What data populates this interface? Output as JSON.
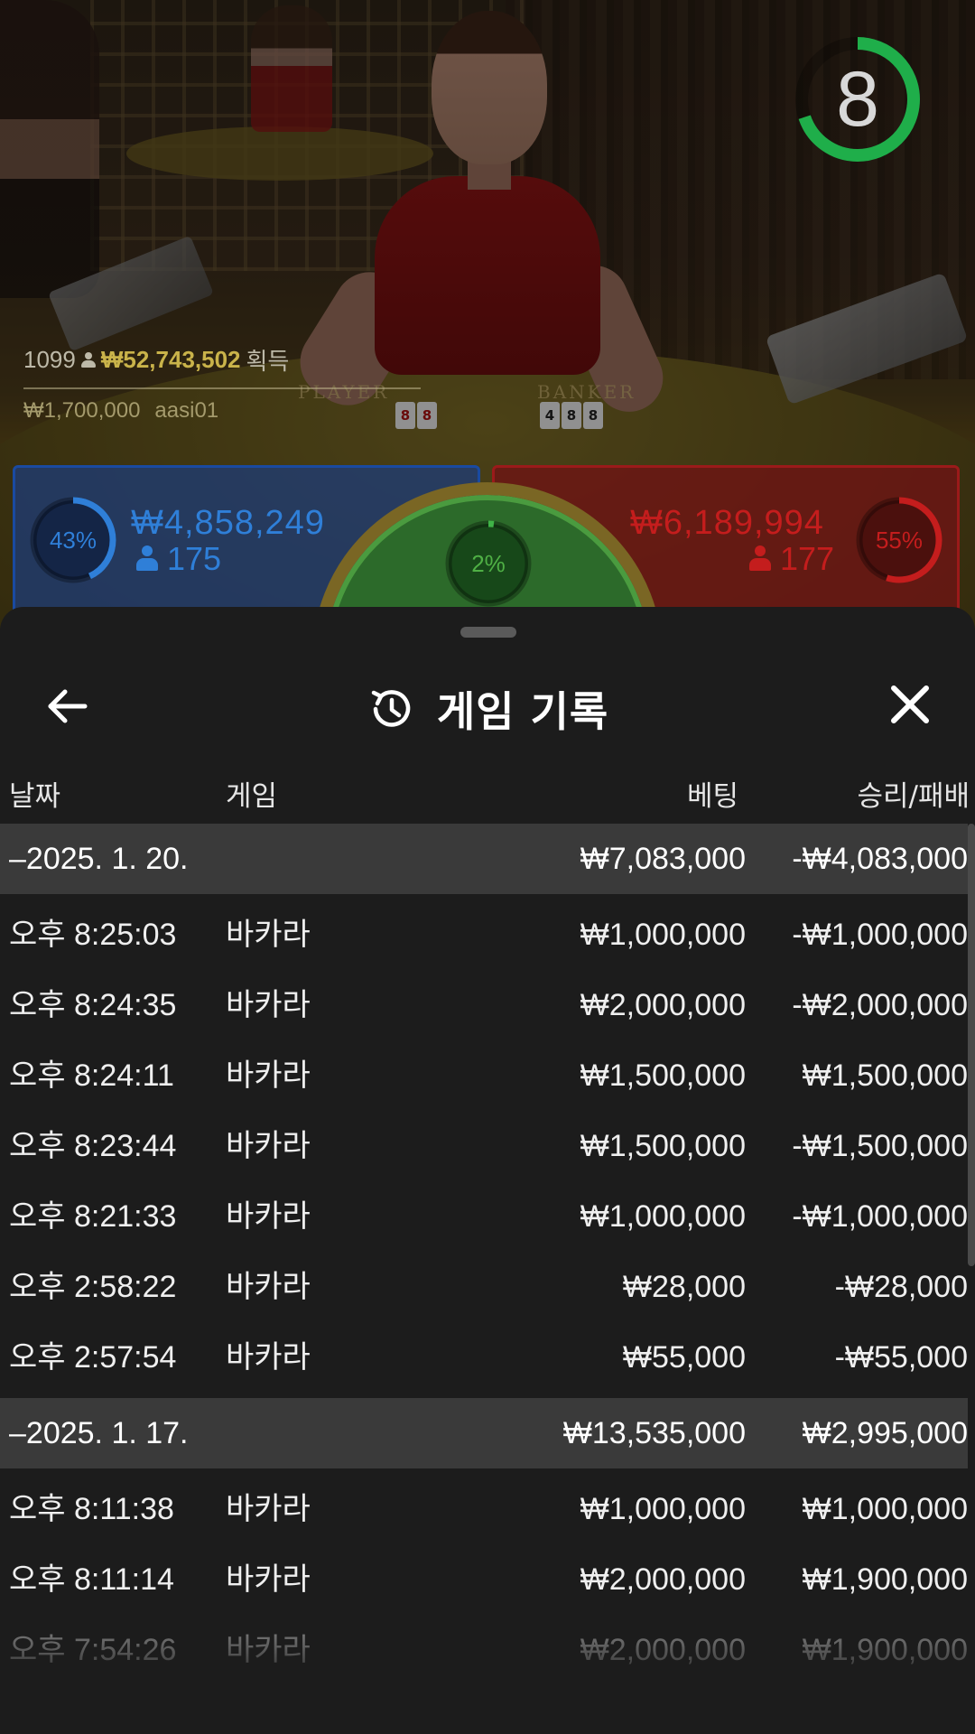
{
  "live": {
    "timer": "8",
    "winner": {
      "count": "1099",
      "amount": "₩52,743,502",
      "suffix": "획득",
      "bet": "₩1,700,000",
      "user": "aasi01"
    },
    "felt": {
      "player": "PLAYER",
      "banker": "BANKER"
    },
    "player": {
      "percent": "43%",
      "amount": "₩4,858,249",
      "count": "175",
      "color": "#2f7fd8"
    },
    "tie": {
      "percent": "2%",
      "color": "#3fb347"
    },
    "banker": {
      "percent": "55%",
      "amount": "₩6,189,994",
      "count": "177",
      "color": "#c41d1d"
    }
  },
  "sheet": {
    "title": "게임 기록",
    "columns": {
      "date": "날짜",
      "game": "게임",
      "bet": "베팅",
      "result": "승리/패배"
    },
    "groups": [
      {
        "date": "–2025. 1. 20.",
        "total_bet": "₩7,083,000",
        "total_result": "-₩4,083,000",
        "rows": [
          {
            "time": "오후 8:25:03",
            "game": "바카라",
            "bet": "₩1,000,000",
            "result": "-₩1,000,000"
          },
          {
            "time": "오후 8:24:35",
            "game": "바카라",
            "bet": "₩2,000,000",
            "result": "-₩2,000,000"
          },
          {
            "time": "오후 8:24:11",
            "game": "바카라",
            "bet": "₩1,500,000",
            "result": "₩1,500,000"
          },
          {
            "time": "오후 8:23:44",
            "game": "바카라",
            "bet": "₩1,500,000",
            "result": "-₩1,500,000"
          },
          {
            "time": "오후 8:21:33",
            "game": "바카라",
            "bet": "₩1,000,000",
            "result": "-₩1,000,000"
          },
          {
            "time": "오후 2:58:22",
            "game": "바카라",
            "bet": "₩28,000",
            "result": "-₩28,000"
          },
          {
            "time": "오후 2:57:54",
            "game": "바카라",
            "bet": "₩55,000",
            "result": "-₩55,000"
          }
        ]
      },
      {
        "date": "–2025. 1. 17.",
        "total_bet": "₩13,535,000",
        "total_result": "₩2,995,000",
        "rows": [
          {
            "time": "오후 8:11:38",
            "game": "바카라",
            "bet": "₩1,000,000",
            "result": "₩1,000,000"
          },
          {
            "time": "오후 8:11:14",
            "game": "바카라",
            "bet": "₩2,000,000",
            "result": "₩1,900,000"
          },
          {
            "time": "오후 7:54:26",
            "game": "바카라",
            "bet": "₩2,000,000",
            "result": "₩1,900,000"
          }
        ]
      }
    ]
  },
  "icons": {
    "back": "arrow-left-icon",
    "history": "history-icon",
    "close": "close-icon"
  }
}
